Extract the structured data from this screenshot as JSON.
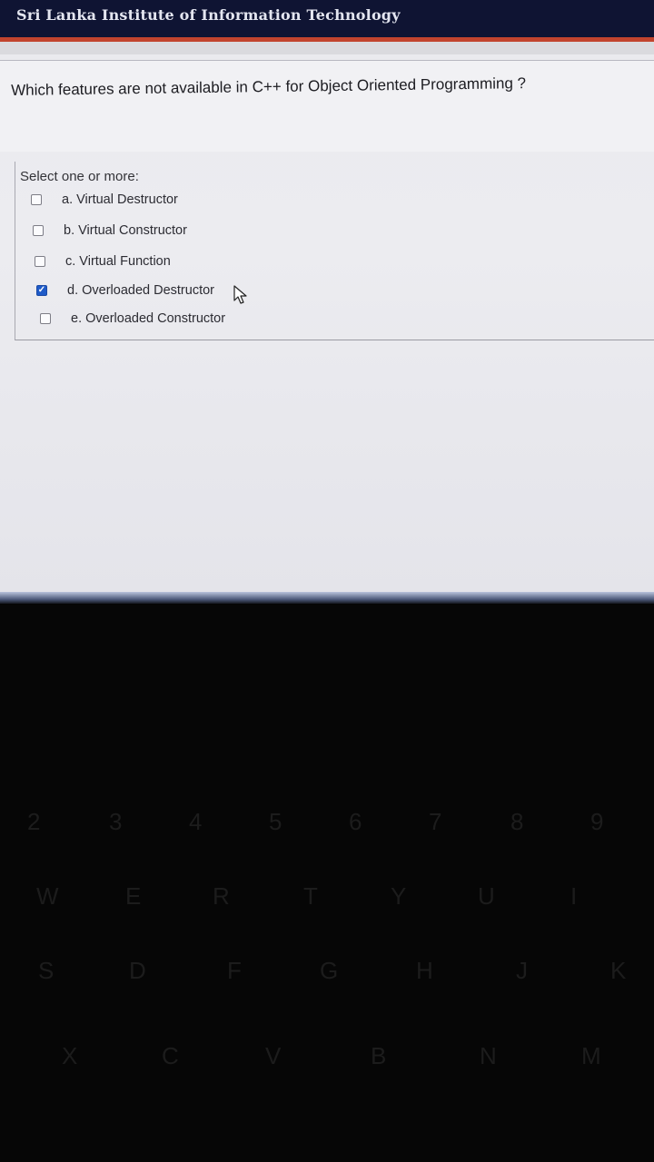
{
  "header": {
    "title": "Sri Lanka Institute of Information Technology"
  },
  "question": {
    "text": "Which features are not available in C++ for Object Oriented Programming ?"
  },
  "answer": {
    "prompt": "Select one or more:",
    "options": [
      {
        "label": "a. Virtual Destructor",
        "checked": false
      },
      {
        "label": "b. Virtual Constructor",
        "checked": false
      },
      {
        "label": "c. Virtual Function",
        "checked": false
      },
      {
        "label": "d. Overloaded Destructor",
        "checked": true
      },
      {
        "label": "e. Overloaded Constructor",
        "checked": false
      }
    ]
  },
  "keyboard": {
    "number_row": [
      "2",
      "3",
      "4",
      "5",
      "6",
      "7",
      "8",
      "9"
    ],
    "top_row": [
      "W",
      "E",
      "R",
      "T",
      "Y",
      "U",
      "I"
    ],
    "home_row": [
      "S",
      "D",
      "F",
      "G",
      "H",
      "J",
      "K"
    ],
    "bottom_row": [
      "X",
      "C",
      "V",
      "B",
      "N",
      "M"
    ]
  },
  "colors": {
    "header_bg": "#0f1433",
    "accent": "#c2442e",
    "checkbox_checked": "#1f5bc8"
  }
}
